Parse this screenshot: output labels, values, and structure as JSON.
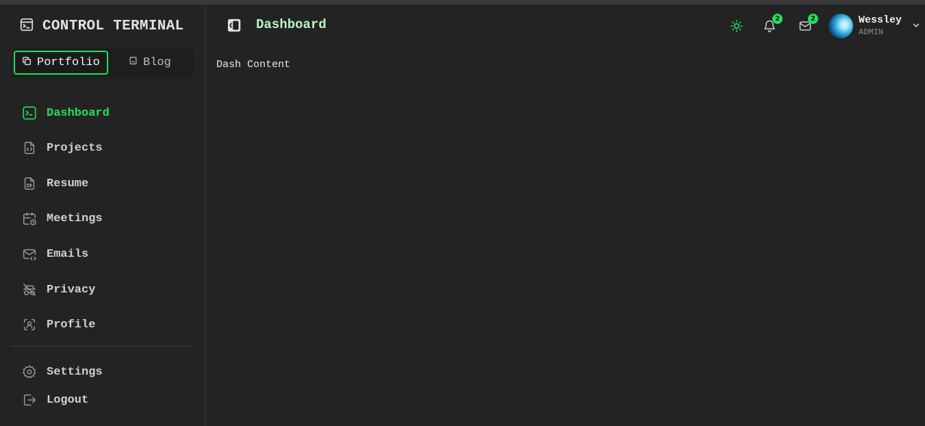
{
  "brand": {
    "title": "CONTROL TERMINAL",
    "icon": "terminal-window-icon"
  },
  "switcher": {
    "portfolio": "Portfolio",
    "blog": "Blog"
  },
  "nav": {
    "items": [
      {
        "label": "Dashboard",
        "icon": "terminal-icon",
        "active": true
      },
      {
        "label": "Projects",
        "icon": "code-file-icon"
      },
      {
        "label": "Resume",
        "icon": "cv-file-icon"
      },
      {
        "label": "Meetings",
        "icon": "calendar-clock-icon"
      },
      {
        "label": "Emails",
        "icon": "mail-code-icon"
      },
      {
        "label": "Privacy",
        "icon": "privacy-off-icon"
      },
      {
        "label": "Profile",
        "icon": "face-scan-icon"
      }
    ],
    "bottom": [
      {
        "label": "Settings",
        "icon": "gear-icon"
      },
      {
        "label": "Logout",
        "icon": "logout-icon"
      }
    ]
  },
  "header": {
    "title": "Dashboard",
    "notifications_count": "2",
    "messages_count": "2",
    "user": {
      "name": "Wessley",
      "role": "ADMIN"
    }
  },
  "main": {
    "content": "Dash Content"
  },
  "colors": {
    "accent": "#22e05a",
    "background": "#232323",
    "title": "#b9f5c8"
  }
}
